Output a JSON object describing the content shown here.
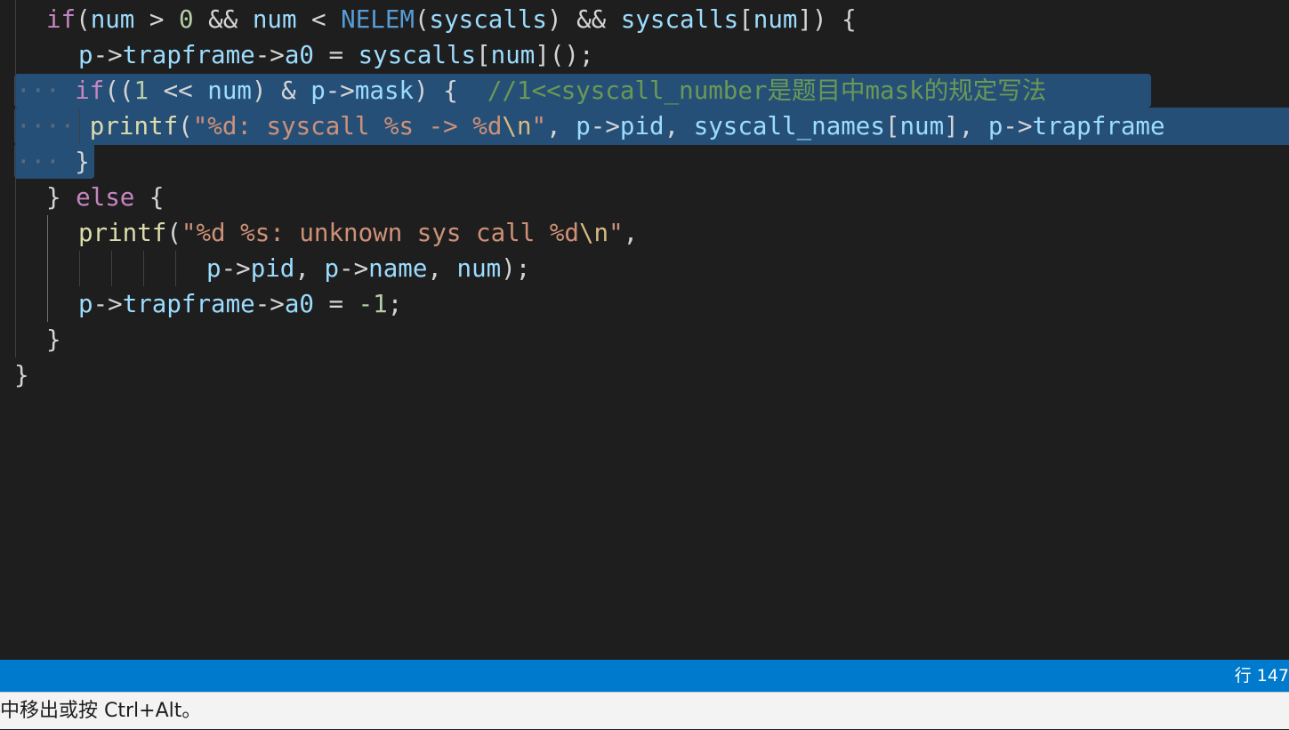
{
  "code": {
    "l1": {
      "t1": "if",
      "t2": "(",
      "t3": "num",
      "t4": " > ",
      "t5": "0",
      "t6": " && ",
      "t7": "num",
      "t8": " < ",
      "t9": "NELEM",
      "t10": "(",
      "t11": "syscalls",
      "t12": ") && ",
      "t13": "syscalls",
      "t14": "[",
      "t15": "num",
      "t16": "]) {"
    },
    "l2": {
      "t1": "p",
      "t2": "->",
      "t3": "trapframe",
      "t4": "->",
      "t5": "a0",
      "t6": " = ",
      "t7": "syscalls",
      "t8": "[",
      "t9": "num",
      "t10": "]();"
    },
    "l3": {
      "ws": "···",
      "t1": "if",
      "t2": "((",
      "t3": "1",
      "t4": " << ",
      "t5": "num",
      "t6": ") & ",
      "t7": "p",
      "t8": "->",
      "t9": "mask",
      "t10": ") {  ",
      "t11": "//1<<syscall_number是题目中mask的规定写法"
    },
    "l4": {
      "ws": "····",
      "t1": "printf",
      "t2": "(",
      "t3": "\"%d: syscall %s -> %d",
      "t4": "\\n",
      "t5": "\"",
      "t6": ", ",
      "t7": "p",
      "t8": "->",
      "t9": "pid",
      "t10": ", ",
      "t11": "syscall_names",
      "t12": "[",
      "t13": "num",
      "t14": "], ",
      "t15": "p",
      "t16": "->",
      "t17": "trapframe"
    },
    "l5": {
      "ws": "···",
      "t1": "}"
    },
    "l6": {
      "t1": "} ",
      "t2": "else",
      "t3": " {"
    },
    "l7": {
      "t1": "printf",
      "t2": "(",
      "t3": "\"%d %s: unknown sys call %d",
      "t4": "\\n",
      "t5": "\"",
      "t6": ","
    },
    "l8": {
      "t1": "p",
      "t2": "->",
      "t3": "pid",
      "t4": ", ",
      "t5": "p",
      "t6": "->",
      "t7": "name",
      "t8": ", ",
      "t9": "num",
      "t10": ");"
    },
    "l9": {
      "t1": "p",
      "t2": "->",
      "t3": "trapframe",
      "t4": "->",
      "t5": "a0",
      "t6": " = ",
      "t7": "-1",
      "t8": ";"
    },
    "l10": {
      "t1": "}"
    },
    "l11": {
      "t1": "}"
    }
  },
  "statusbar": {
    "position": "行 147"
  },
  "hint": {
    "text": "中移出或按 Ctrl+Alt。"
  },
  "colors": {
    "editor_bg": "#1e1e1e",
    "selection": "#264f78",
    "keyword": "#c586c0",
    "variable": "#9cdcfe",
    "number": "#b5cea8",
    "macro": "#569cd6",
    "function": "#dcdcaa",
    "string": "#ce9178",
    "comment": "#6a9955",
    "statusbar": "#007acc"
  }
}
